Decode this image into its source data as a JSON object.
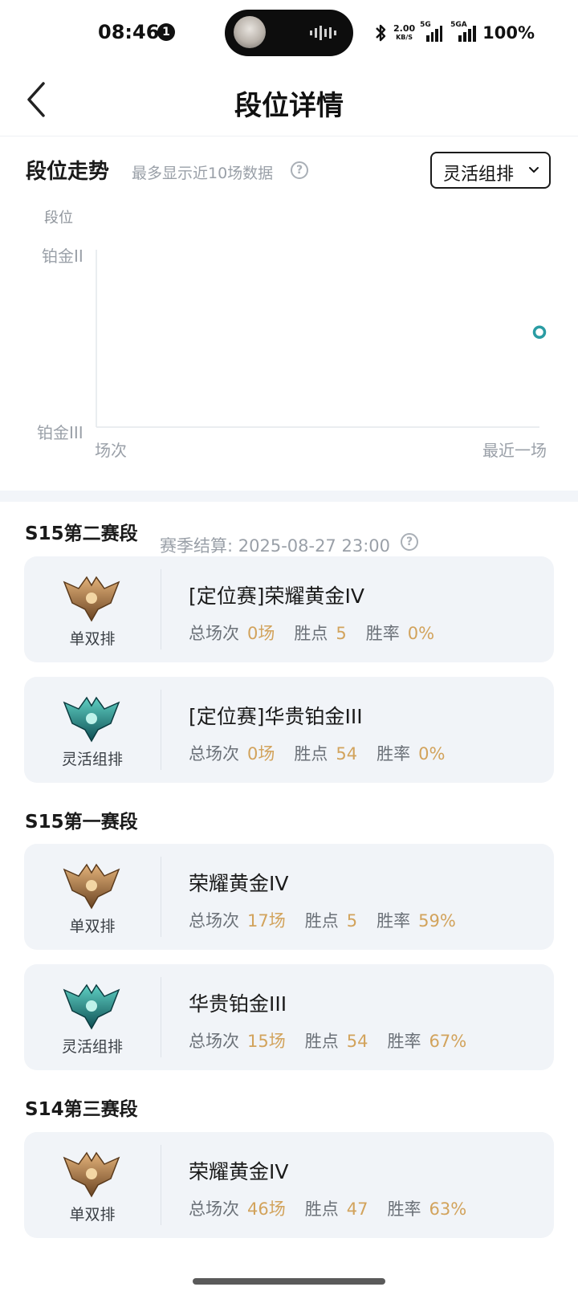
{
  "status_bar": {
    "time": "08:46",
    "notification_count": "1",
    "net_speed": "2.00",
    "net_speed_unit": "KB/S",
    "signal1_tag": "5G",
    "signal2_tag": "5GA",
    "battery": "100%"
  },
  "nav": {
    "title": "段位详情",
    "back_icon": "chevron-left-icon"
  },
  "trend": {
    "title": "段位走势",
    "subtitle": "最多显示近10场数据",
    "help_glyph": "?",
    "mode_selected": "灵活组排"
  },
  "chart_data": {
    "type": "scatter",
    "ylabel": "段位",
    "y_ticks": [
      "铂金II",
      "铂金III"
    ],
    "x_ticks": [
      "场次",
      "最近一场"
    ],
    "point_color": "#2a9ca3",
    "point": {
      "x": "最近一场",
      "y_fraction_between_ticks": 0.54
    }
  },
  "seasons": [
    {
      "title": "S15第二赛段",
      "note": "赛季结算: 2025-08-27 23:00",
      "help_glyph": "?",
      "cards": [
        {
          "queue": "单双排",
          "emblem": "gold",
          "rank": "[定位赛]荣耀黄金IV",
          "games_label": "总场次",
          "games": "0场",
          "lp_label": "胜点",
          "lp": "5",
          "wr_label": "胜率",
          "wr": "0%"
        },
        {
          "queue": "灵活组排",
          "emblem": "platinum",
          "rank": "[定位赛]华贵铂金III",
          "games_label": "总场次",
          "games": "0场",
          "lp_label": "胜点",
          "lp": "54",
          "wr_label": "胜率",
          "wr": "0%"
        }
      ]
    },
    {
      "title": "S15第一赛段",
      "cards": [
        {
          "queue": "单双排",
          "emblem": "gold",
          "rank": "荣耀黄金IV",
          "games_label": "总场次",
          "games": "17场",
          "lp_label": "胜点",
          "lp": "5",
          "wr_label": "胜率",
          "wr": "59%"
        },
        {
          "queue": "灵活组排",
          "emblem": "platinum",
          "rank": "华贵铂金III",
          "games_label": "总场次",
          "games": "15场",
          "lp_label": "胜点",
          "lp": "54",
          "wr_label": "胜率",
          "wr": "67%"
        }
      ]
    },
    {
      "title": "S14第三赛段",
      "cards": [
        {
          "queue": "单双排",
          "emblem": "gold",
          "rank": "荣耀黄金IV",
          "games_label": "总场次",
          "games": "46场",
          "lp_label": "胜点",
          "lp": "47",
          "wr_label": "胜率",
          "wr": "63%"
        }
      ]
    }
  ],
  "colors": {
    "accent_value": "#d2a35c",
    "card_bg": "#f1f4f8",
    "gold_emblem": "#b8834a",
    "platinum_emblem": "#1f8c8a"
  }
}
